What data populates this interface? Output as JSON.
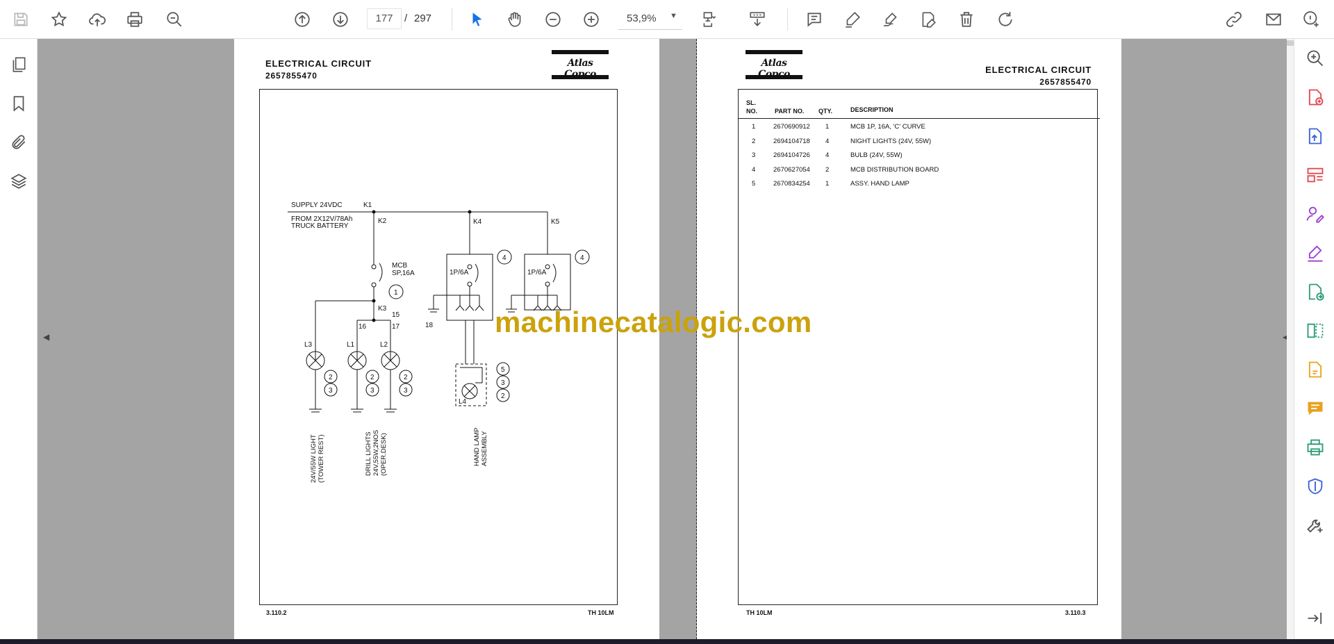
{
  "toolbar": {
    "page_current": "177",
    "page_separator": "/",
    "page_total": "297",
    "zoom": "53,9%",
    "accent_color": "#1473e6"
  },
  "document": {
    "left_page": {
      "title": "ELECTRICAL CIRCUIT",
      "number": "2657855470",
      "logo": "Atlas Copco",
      "footer_left": "3.110.2",
      "footer_right": "TH 10LM",
      "diagram": {
        "supply": "SUPPLY  24VDC",
        "k1": "K1",
        "k2": "K2",
        "k3": "K3",
        "k4": "K4",
        "k5": "K5",
        "battery_line1": "FROM  2X12V/78Ah",
        "battery_line2": "TRUCK  BATTERY",
        "mcb_line1": "MCB",
        "mcb_line2": "SP,16A",
        "breaker_a": "1P/6A",
        "breaker_b": "1P/6A",
        "n15": "15",
        "n16": "16",
        "n17": "17",
        "n18": "18",
        "l1": "L1",
        "l2": "L2",
        "l3": "L3",
        "l4": "L4",
        "c1": "1",
        "c2": "2",
        "c3": "3",
        "c4": "4",
        "c5": "5",
        "cap_a1": "24V/55W  LIGHT",
        "cap_a2": "(TOWER  REST)",
        "cap_b1": "DRILL  LIGHTS",
        "cap_b2": "24V,55W,2NOS",
        "cap_b3": "(OPER.DESK)",
        "cap_c1": "HAND  LAMP",
        "cap_c2": "ASSEMBLY"
      }
    },
    "right_page": {
      "title": "ELECTRICAL CIRCUIT",
      "number": "2657855470",
      "logo": "Atlas Copco",
      "footer_left": "TH 10LM",
      "footer_right": "3.110.3",
      "table": {
        "headers": {
          "sl": "SL.",
          "no": "NO.",
          "part": "PART NO.",
          "qty": "QTY.",
          "desc": "DESCRIPTION"
        },
        "rows": [
          {
            "sl": "1",
            "part": "2670690912",
            "qty": "1",
            "desc": "MCB 1P, 16A, 'C' CURVE"
          },
          {
            "sl": "2",
            "part": "2694104718",
            "qty": "4",
            "desc": "NIGHT LIGHTS (24V, 55W)"
          },
          {
            "sl": "3",
            "part": "2694104726",
            "qty": "4",
            "desc": "BULB (24V, 55W)"
          },
          {
            "sl": "4",
            "part": "2670627054",
            "qty": "2",
            "desc": "MCB DISTRIBUTION BOARD"
          },
          {
            "sl": "5",
            "part": "2670834254",
            "qty": "1",
            "desc": "ASSY. HAND LAMP"
          }
        ]
      }
    },
    "watermark": "machinecatalogic.com"
  }
}
